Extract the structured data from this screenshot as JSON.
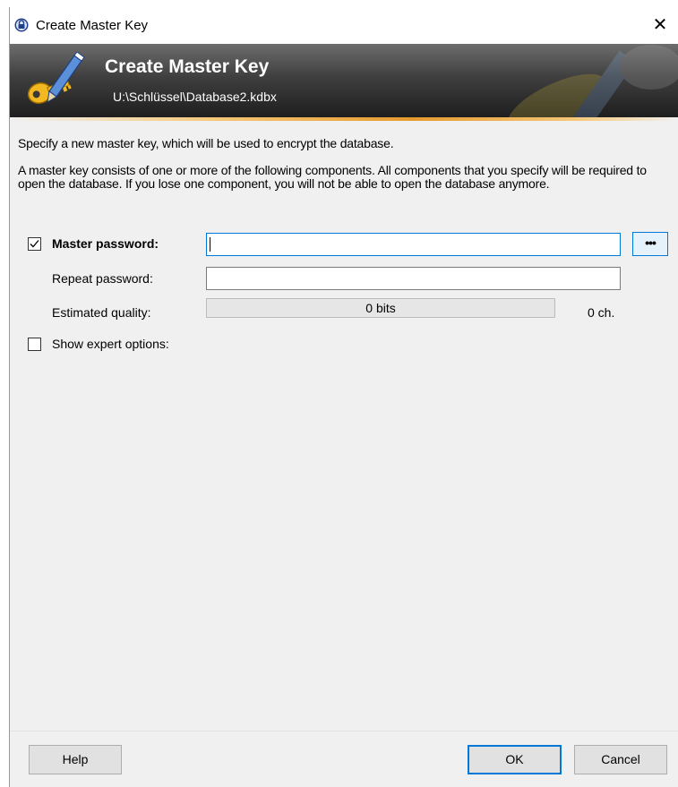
{
  "window": {
    "title": "Create Master Key",
    "close_glyph": "✕",
    "icon": "lock-icon"
  },
  "banner": {
    "title": "Create Master Key",
    "subtitle": "U:\\Schlüssel\\Database2.kdbx",
    "icon": "key-pen-icon"
  },
  "intro": {
    "line1": "Specify a new master key, which will be used to encrypt the database.",
    "line2": "A master key consists of one or more of the following components. All components that you specify will be required to open the database. If you lose one component, you will not be able to open the database anymore."
  },
  "master_password": {
    "label": "Master password:",
    "checked": true,
    "value": "",
    "reveal_button": "•••"
  },
  "repeat_password": {
    "label": "Repeat password:",
    "value": ""
  },
  "quality": {
    "label": "Estimated quality:",
    "bits_text": "0 bits",
    "chars_text": "0 ch.",
    "level": 0
  },
  "expert": {
    "label": "Show expert options:",
    "checked": false
  },
  "buttons": {
    "help": "Help",
    "ok": "OK",
    "cancel": "Cancel"
  },
  "colors": {
    "accent": "#0078d7",
    "banner_dark": "#1e1e1e",
    "banner_line": "#e69a2e",
    "dialog_bg": "#f0f0f0"
  }
}
